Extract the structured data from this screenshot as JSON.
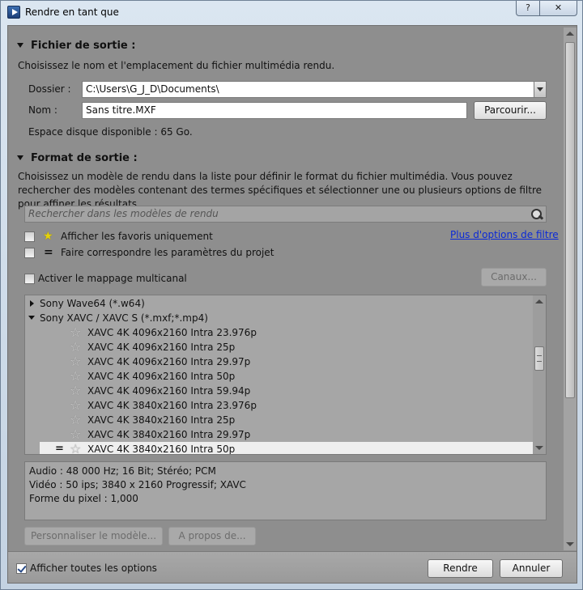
{
  "window": {
    "title": "Rendre en tant que",
    "help_label": "?",
    "close_label": "✕"
  },
  "output_file": {
    "title": "Fichier de sortie :",
    "description": "Choisissez le nom et l'emplacement du fichier multimédia rendu.",
    "folder_label": "Dossier :",
    "folder_value": "C:\\Users\\G_J_D\\Documents\\",
    "name_label": "Nom :",
    "name_value": "Sans titre.MXF",
    "browse_label": "Parcourir...",
    "disk_space": "Espace disque disponible : 65 Go."
  },
  "output_format": {
    "title": "Format de sortie :",
    "description": "Choisissez un modèle de rendu dans la liste pour définir le format du fichier multimédia. Vous pouvez rechercher des modèles contenant des termes spécifiques et sélectionner une ou plusieurs options de filtre pour affiner les résultats.",
    "search_placeholder": "Rechercher dans les modèles de rendu",
    "favorites_label": "Afficher les favoris uniquement",
    "match_project_label": "Faire correspondre les paramètres du projet",
    "more_filters_label": "Plus d'options de filtre",
    "multichannel_label": "Activer le mappage multicanal",
    "channels_label": "Canaux...",
    "favorites_checked": false,
    "match_project_checked": false,
    "multichannel_checked": false
  },
  "templates": {
    "groups": [
      {
        "label": "Sony Wave64 (*.w64)",
        "expanded": false
      },
      {
        "label": "Sony XAVC / XAVC S (*.mxf;*.mp4)",
        "expanded": true
      }
    ],
    "items": [
      "XAVC 4K 4096x2160 Intra 23.976p",
      "XAVC 4K 4096x2160 Intra 25p",
      "XAVC 4K 4096x2160 Intra 29.97p",
      "XAVC 4K 4096x2160 Intra 50p",
      "XAVC 4K 4096x2160 Intra 59.94p",
      "XAVC 4K 3840x2160 Intra 23.976p",
      "XAVC 4K 3840x2160 Intra 25p",
      "XAVC 4K 3840x2160 Intra 29.97p",
      "XAVC 4K 3840x2160 Intra 50p"
    ],
    "selected_index": 8,
    "selected_marker": "="
  },
  "details": {
    "audio": "Audio : 48 000 Hz; 16 Bit; Stéréo; PCM",
    "video": "Vidéo : 50 ips; 3840 x 2160 Progressif; XAVC",
    "pixel": "Forme du pixel : 1,000"
  },
  "actions": {
    "customize_label": "Personnaliser le modèle...",
    "about_label": "A propos de..."
  },
  "footer": {
    "show_all_label": "Afficher toutes les options",
    "show_all_checked": true,
    "render_label": "Rendre",
    "cancel_label": "Annuler"
  }
}
